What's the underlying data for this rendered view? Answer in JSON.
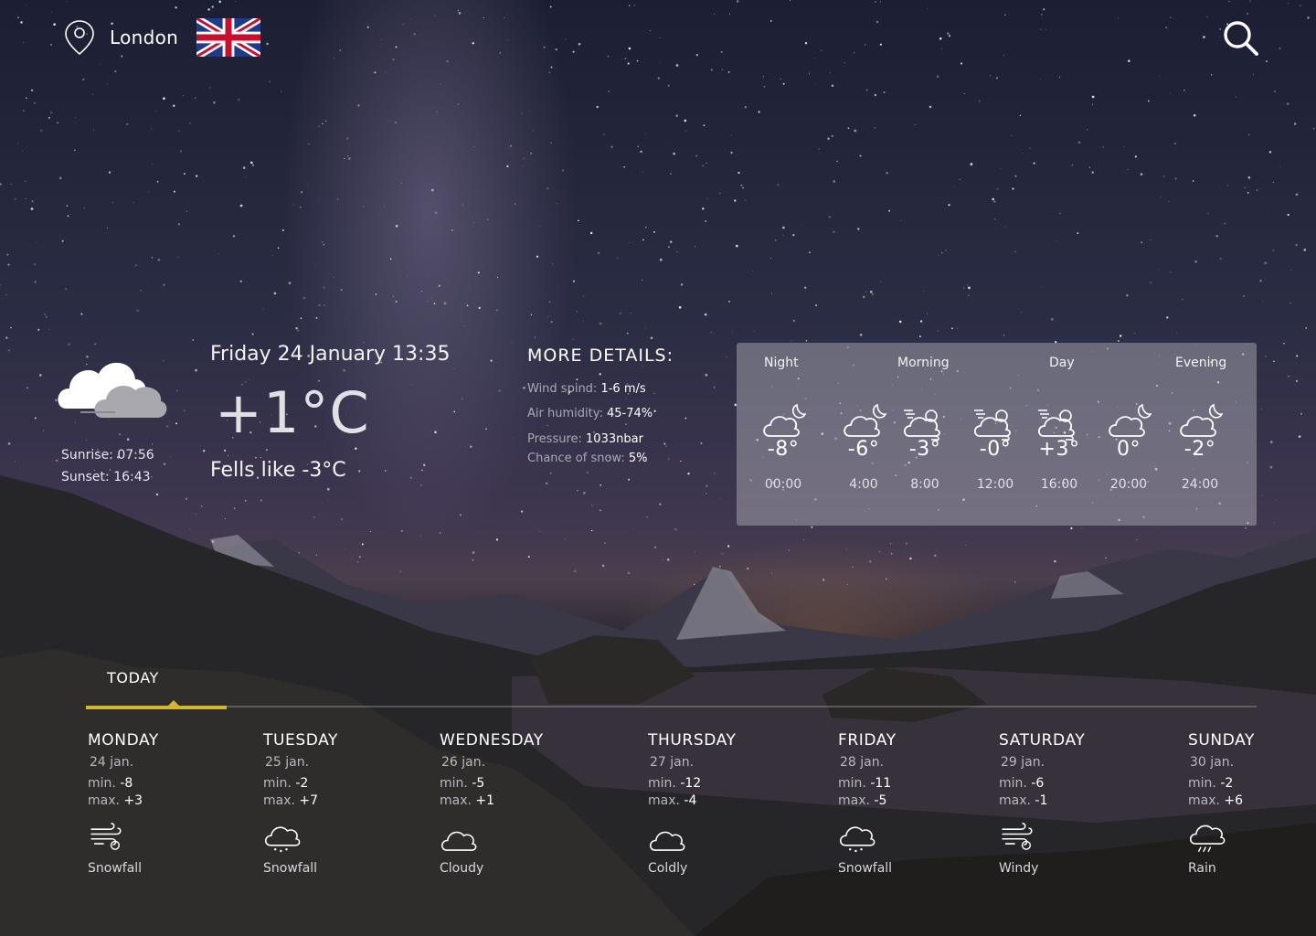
{
  "header": {
    "location_icon": "map-pin-icon",
    "city": "London",
    "flag": "uk-flag",
    "search_icon": "search-icon"
  },
  "current": {
    "icon": "cloudy-icon",
    "sunrise": "Sunrise: 07:56",
    "sunset": "Sunset: 16:43",
    "datetime": "Friday 24 January 13:35",
    "temperature": "+1°C",
    "feels_like": "Fells like -3°C"
  },
  "details": {
    "title": "MORE DETAILS:",
    "rows": [
      {
        "label": "Wind spind: ",
        "value": "1-6 m/s"
      },
      {
        "label": "Air humidity: ",
        "value": "45-74%"
      },
      {
        "label": "Pressure: ",
        "value": "1033nbar"
      },
      {
        "label": "Chance of snow: ",
        "value": "5%"
      }
    ]
  },
  "hourly": {
    "periods": [
      "Night",
      "Morning",
      "Day",
      "Evening"
    ],
    "items": [
      {
        "temp": "-8°",
        "time": "00:00",
        "icon": "cloud-moon-icon"
      },
      {
        "temp": "-6°",
        "time": "4:00",
        "icon": "cloud-moon-icon"
      },
      {
        "temp": "-3°",
        "time": "8:00",
        "icon": "cloud-sun-wind-icon"
      },
      {
        "temp": "-0°",
        "time": "12:00",
        "icon": "cloud-sun-wind-icon"
      },
      {
        "temp": "+3°",
        "time": "16:00",
        "icon": "cloud-sun-wind-icon"
      },
      {
        "temp": "0°",
        "time": "20:00",
        "icon": "cloud-moon-icon"
      },
      {
        "temp": "-2°",
        "time": "24:00",
        "icon": "cloud-moon-icon"
      }
    ]
  },
  "forecast": {
    "tab": "TODAY",
    "min_label": "min. ",
    "max_label": "max. ",
    "accent_color": "#d4b62a",
    "days": [
      {
        "name": "MONDAY",
        "date": "24 jan.",
        "min": "-8",
        "max": "+3",
        "condition": "Snowfall",
        "icon": "wind-icon"
      },
      {
        "name": "TUESDAY",
        "date": "25 jan.",
        "min": "-2",
        "max": "+7",
        "condition": "Snowfall",
        "icon": "snow-cloud-icon"
      },
      {
        "name": "WEDNESDAY",
        "date": "26 jan.",
        "min": "-5",
        "max": "+1",
        "condition": "Cloudy",
        "icon": "cloud-icon"
      },
      {
        "name": "THURSDAY",
        "date": "27 jan.",
        "min": "-12",
        "max": "-4",
        "condition": "Coldly",
        "icon": "cloud-icon"
      },
      {
        "name": "FRIDAY",
        "date": "28 jan.",
        "min": "-11",
        "max": "-5",
        "condition": "Snowfall",
        "icon": "snow-cloud-icon"
      },
      {
        "name": "SATURDAY",
        "date": "29 jan.",
        "min": "-6",
        "max": "-1",
        "condition": "Windy",
        "icon": "wind-icon"
      },
      {
        "name": "SUNDAY",
        "date": "30 jan.",
        "min": "-2",
        "max": "+6",
        "condition": "Rain",
        "icon": "rain-cloud-icon"
      }
    ]
  }
}
